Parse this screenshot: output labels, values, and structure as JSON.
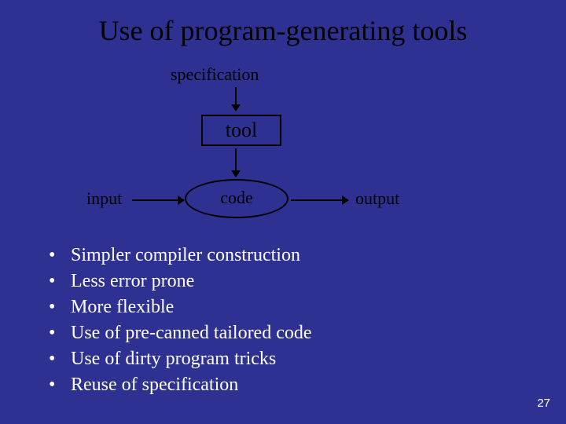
{
  "title": "Use of program-generating tools",
  "diagram": {
    "specification": "specification",
    "tool": "tool",
    "code": "code",
    "input": "input",
    "output": "output"
  },
  "bullets": [
    "Simpler compiler construction",
    "Less error prone",
    "More flexible",
    "Use of pre-canned tailored code",
    "Use of dirty program tricks",
    "Reuse of specification"
  ],
  "page_number": "27"
}
